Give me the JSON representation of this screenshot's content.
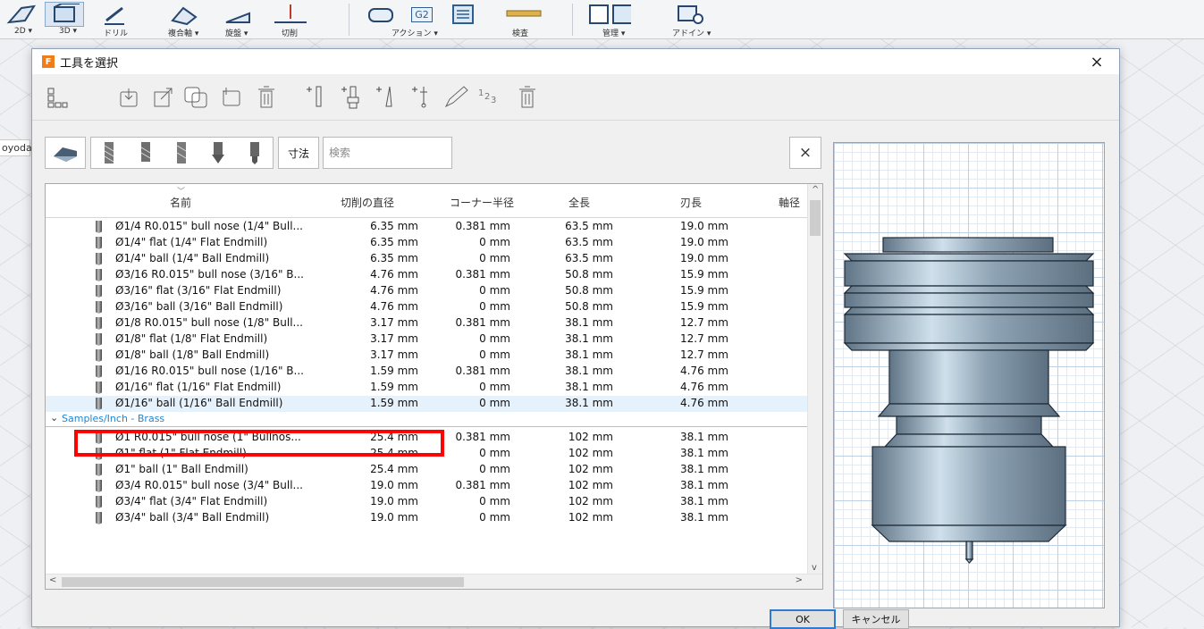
{
  "ribbon": {
    "items": [
      {
        "label": "2D ▾",
        "icon": "2d-icon"
      },
      {
        "label": "3D ▾",
        "icon": "3d-icon"
      },
      {
        "label": "ドリル",
        "icon": "drill-icon"
      },
      {
        "label": "複合軸 ▾",
        "icon": "multiaxis-icon"
      },
      {
        "label": "旋盤 ▾",
        "icon": "lathe-icon"
      },
      {
        "label": "切削",
        "icon": "cutting-icon"
      },
      {
        "label": "アクション ▾",
        "icon": "actions-icon"
      },
      {
        "label": "検査",
        "icon": "inspect-icon"
      },
      {
        "label": "管理 ▾",
        "icon": "manage-icon"
      },
      {
        "label": "アドイン ▾",
        "icon": "addins-icon"
      }
    ],
    "g2_badge": "G2"
  },
  "left_panel": {
    "text": "oyoda"
  },
  "dialog": {
    "title": "工具を選択",
    "logo_letter": "F",
    "close_symbol": "×"
  },
  "filter": {
    "dimension_label": "寸法",
    "search_placeholder": "検索",
    "clear_symbol": "×"
  },
  "table": {
    "columns": [
      "名前",
      "切削の直径",
      "コーナー半径",
      "全長",
      "刃長",
      "軸径"
    ],
    "rows": [
      {
        "name": "Ø1/4 R0.015\" bull nose (1/4\" Bull...",
        "diameter": "6.35 mm",
        "corner": "0.381 mm",
        "overall": "63.5 mm",
        "flute": "19.0 mm",
        "selected": false
      },
      {
        "name": "Ø1/4\" flat (1/4\" Flat Endmill)",
        "diameter": "6.35 mm",
        "corner": "0 mm",
        "overall": "63.5 mm",
        "flute": "19.0 mm",
        "selected": false
      },
      {
        "name": "Ø1/4\" ball (1/4\" Ball Endmill)",
        "diameter": "6.35 mm",
        "corner": "0 mm",
        "overall": "63.5 mm",
        "flute": "19.0 mm",
        "selected": false
      },
      {
        "name": "Ø3/16 R0.015\" bull nose (3/16\" B...",
        "diameter": "4.76 mm",
        "corner": "0.381 mm",
        "overall": "50.8 mm",
        "flute": "15.9 mm",
        "selected": false
      },
      {
        "name": "Ø3/16\" flat (3/16\" Flat Endmill)",
        "diameter": "4.76 mm",
        "corner": "0 mm",
        "overall": "50.8 mm",
        "flute": "15.9 mm",
        "selected": false
      },
      {
        "name": "Ø3/16\" ball (3/16\" Ball Endmill)",
        "diameter": "4.76 mm",
        "corner": "0 mm",
        "overall": "50.8 mm",
        "flute": "15.9 mm",
        "selected": false
      },
      {
        "name": "Ø1/8 R0.015\" bull nose (1/8\" Bull...",
        "diameter": "3.17 mm",
        "corner": "0.381 mm",
        "overall": "38.1 mm",
        "flute": "12.7 mm",
        "selected": false
      },
      {
        "name": "Ø1/8\" flat (1/8\" Flat Endmill)",
        "diameter": "3.17 mm",
        "corner": "0 mm",
        "overall": "38.1 mm",
        "flute": "12.7 mm",
        "selected": false
      },
      {
        "name": "Ø1/8\" ball (1/8\" Ball Endmill)",
        "diameter": "3.17 mm",
        "corner": "0 mm",
        "overall": "38.1 mm",
        "flute": "12.7 mm",
        "selected": false
      },
      {
        "name": "Ø1/16 R0.015\" bull nose (1/16\" B...",
        "diameter": "1.59 mm",
        "corner": "0.381 mm",
        "overall": "38.1 mm",
        "flute": "4.76 mm",
        "selected": false
      },
      {
        "name": "Ø1/16\" flat (1/16\" Flat Endmill)",
        "diameter": "1.59 mm",
        "corner": "0 mm",
        "overall": "38.1 mm",
        "flute": "4.76 mm",
        "selected": false
      },
      {
        "name": "Ø1/16\" ball (1/16\" Ball Endmill)",
        "diameter": "1.59 mm",
        "corner": "0 mm",
        "overall": "38.1 mm",
        "flute": "4.76 mm",
        "selected": true
      }
    ],
    "group_label": "Samples/Inch - Brass",
    "rows2": [
      {
        "name": "Ø1 R0.015\" bull nose (1\" Bullnos...",
        "diameter": "25.4 mm",
        "corner": "0.381 mm",
        "overall": "102 mm",
        "flute": "38.1 mm"
      },
      {
        "name": "Ø1\" flat (1\" Flat Endmill)",
        "diameter": "25.4 mm",
        "corner": "0 mm",
        "overall": "102 mm",
        "flute": "38.1 mm"
      },
      {
        "name": "Ø1\" ball (1\" Ball Endmill)",
        "diameter": "25.4 mm",
        "corner": "0 mm",
        "overall": "102 mm",
        "flute": "38.1 mm"
      },
      {
        "name": "Ø3/4 R0.015\" bull nose (3/4\" Bull...",
        "diameter": "19.0 mm",
        "corner": "0.381 mm",
        "overall": "102 mm",
        "flute": "38.1 mm"
      },
      {
        "name": "Ø3/4\" flat (3/4\" Flat Endmill)",
        "diameter": "19.0 mm",
        "corner": "0 mm",
        "overall": "102 mm",
        "flute": "38.1 mm"
      },
      {
        "name": "Ø3/4\" ball (3/4\" Ball Endmill)",
        "diameter": "19.0 mm",
        "corner": "0 mm",
        "overall": "102 mm",
        "flute": "38.1 mm"
      }
    ]
  },
  "buttons": {
    "ok": "OK",
    "cancel": "キャンセル"
  },
  "colors": {
    "highlight": "#ff0000",
    "accent": "#1f86d1",
    "selected_row": "#e5f1fb"
  }
}
